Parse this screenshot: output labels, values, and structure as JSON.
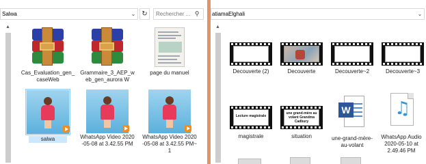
{
  "left_window": {
    "address": "Salwa",
    "search_placeholder": "Rechercher ...",
    "files": [
      {
        "name": "Cas_Evaluation_gen_caseWeb",
        "icon": "winrar-archive-icon"
      },
      {
        "name": "Grammaire_3_AEP_web_gen_aurora W",
        "icon": "winrar-archive-icon"
      },
      {
        "name": "page du manuel",
        "icon": "document-image-icon"
      },
      {
        "name": "salwa",
        "icon": "video-thumbnail"
      },
      {
        "name": "WhatsApp Video 2020-05-08 at 3.42.55 PM",
        "icon": "video-thumbnail"
      },
      {
        "name": "WhatsApp Video 2020-05-08 at 3.42.55 PM~1",
        "icon": "video-thumbnail"
      }
    ]
  },
  "right_window": {
    "address": "atiamaElghali",
    "files": [
      {
        "name": "Decouverte (2)",
        "icon": "film-strip-icon"
      },
      {
        "name": "Decouverte",
        "icon": "film-strip-icon"
      },
      {
        "name": "Decouverte~2",
        "icon": "film-strip-icon"
      },
      {
        "name": "Decouverte~3",
        "icon": "film-strip-icon"
      },
      {
        "name": "magistrale",
        "icon": "film-strip-icon",
        "frame_text": "Lecture magistrale"
      },
      {
        "name": "situation",
        "icon": "film-strip-icon",
        "frame_text": "une grand-mère au volant Grandma Cadbury"
      },
      {
        "name": "une-grand-mère-au-volant",
        "icon": "word-document-icon"
      },
      {
        "name": "WhatsApp Audio 2020-05-10 at 2.49.46 PM",
        "icon": "audio-file-icon"
      }
    ]
  },
  "colors": {
    "selection": "#cce8ff",
    "divider": "#e2936a",
    "word_blue": "#2b579a",
    "audio_blue": "#2e97d8"
  }
}
